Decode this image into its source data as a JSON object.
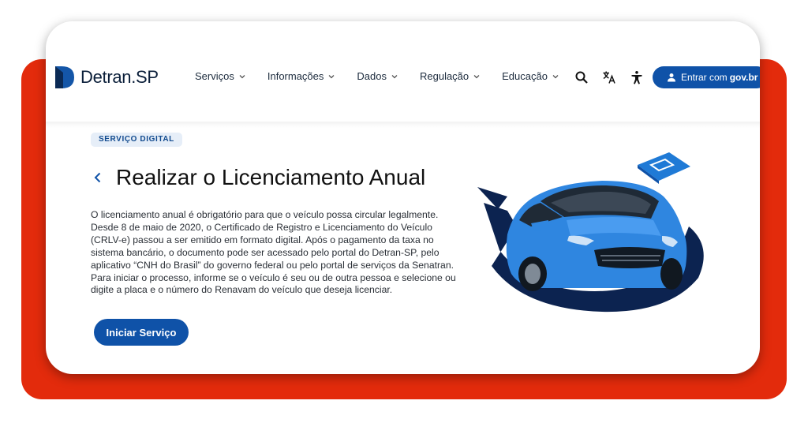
{
  "logo": {
    "text_regular": "Detran",
    "text_suffix": ".SP"
  },
  "nav": {
    "items": [
      {
        "label": "Serviços"
      },
      {
        "label": "Informações"
      },
      {
        "label": "Dados"
      },
      {
        "label": "Regulação"
      },
      {
        "label": "Educação"
      }
    ]
  },
  "tools": {
    "icons": [
      "search-icon",
      "translate-icon",
      "accessibility-icon"
    ]
  },
  "login": {
    "label": "Entrar com",
    "label_bold": "gov.br",
    "icon": "user-icon"
  },
  "main": {
    "badge": "SERVIÇO DIGITAL",
    "title": "Realizar o Licenciamento Anual",
    "description": "O licenciamento anual é obrigatório para que o veículo possa circular legalmente. Desde 8 de maio de 2020, o Certificado de Registro e Licenciamento do Veículo (CRLV-e) passou a ser emitido em formato digital. Após o pagamento da taxa no sistema bancário, o documento pode ser acessado pelo portal do Detran-SP, pelo aplicativo “CNH do Brasil” do governo federal ou pelo portal de serviços da Senatran. Para iniciar o processo, informe se o veículo é seu ou de outra pessoa e selecione ou digite a placa e o número do Renavam do veículo que deseja licenciar.",
    "cta_label": "Iniciar Serviço"
  },
  "colors": {
    "frame_red": "#e32b0c",
    "brand_blue": "#0f52a8",
    "badge_bg": "#e6eef8",
    "navy": "#0b1f3a"
  }
}
